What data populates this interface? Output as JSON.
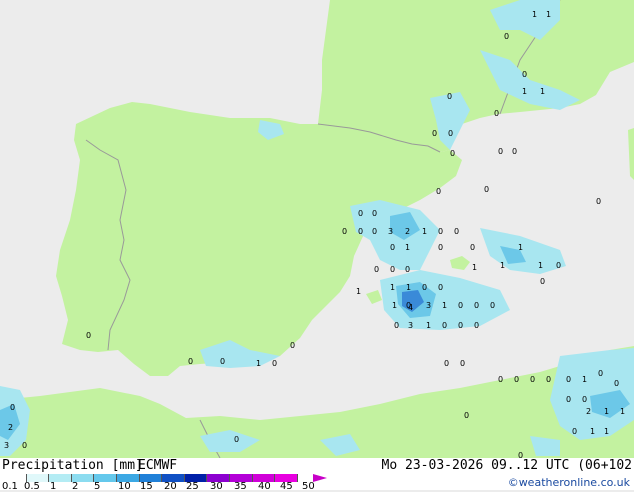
{
  "title": "Precipitation [mm]",
  "model": "ECMWF",
  "valid_time": "Mo 23-03-2026 09..12 UTC (06+102",
  "credit": "©weatheronline.co.uk",
  "colors": {
    "land": "#c3f2a0",
    "sea": "#ececec",
    "border": "#999999",
    "light_precip": "#a8e6f0",
    "medium_precip": "#6cc8e8",
    "heavy_precip": "#3a8ad8"
  },
  "scale": {
    "ticks": [
      "0.1",
      "0.5",
      "1",
      "2",
      "5",
      "10",
      "15",
      "20",
      "25",
      "30",
      "35",
      "40",
      "45",
      "50"
    ],
    "colors": [
      "#ffffff",
      "#e0f8fa",
      "#b4ecf4",
      "#8cdcf0",
      "#64c8ec",
      "#3ca8e4",
      "#2080d8",
      "#1050c4",
      "#0020a8",
      "#8c00d0",
      "#b400d8",
      "#d000d8",
      "#e800e0"
    ]
  },
  "map_labels": [
    {
      "text": "1"
    },
    {
      "text": "1"
    },
    {
      "text": "0"
    },
    {
      "text": "0"
    },
    {
      "text": "1"
    },
    {
      "text": "1"
    },
    {
      "text": "0"
    },
    {
      "text": "0"
    },
    {
      "text": "0"
    },
    {
      "text": "0"
    },
    {
      "text": "0"
    },
    {
      "text": "0"
    },
    {
      "text": "0"
    },
    {
      "text": "0"
    },
    {
      "text": "0"
    },
    {
      "text": "0"
    },
    {
      "text": "0"
    },
    {
      "text": "0"
    },
    {
      "text": "0"
    },
    {
      "text": "0"
    },
    {
      "text": "0"
    },
    {
      "text": "3"
    },
    {
      "text": "2"
    },
    {
      "text": "1"
    },
    {
      "text": "0"
    },
    {
      "text": "0"
    },
    {
      "text": "0"
    },
    {
      "text": "1"
    },
    {
      "text": "0"
    },
    {
      "text": "0"
    },
    {
      "text": "1"
    },
    {
      "text": "0"
    },
    {
      "text": "0"
    },
    {
      "text": "0"
    },
    {
      "text": "1"
    },
    {
      "text": "1"
    },
    {
      "text": "0"
    },
    {
      "text": "0"
    },
    {
      "text": "1"
    },
    {
      "text": "1"
    },
    {
      "text": "1"
    },
    {
      "text": "1"
    },
    {
      "text": "0"
    },
    {
      "text": "0"
    },
    {
      "text": "1"
    },
    {
      "text": "0"
    },
    {
      "text": "4"
    },
    {
      "text": "3"
    },
    {
      "text": "1"
    },
    {
      "text": "0"
    },
    {
      "text": "0"
    },
    {
      "text": "0"
    },
    {
      "text": "3"
    },
    {
      "text": "1"
    },
    {
      "text": "0"
    },
    {
      "text": "0"
    },
    {
      "text": "0"
    },
    {
      "text": "0"
    },
    {
      "text": "0"
    },
    {
      "text": "0"
    },
    {
      "text": "1"
    },
    {
      "text": "0"
    },
    {
      "text": "0"
    },
    {
      "text": "0"
    },
    {
      "text": "0"
    },
    {
      "text": "0"
    },
    {
      "text": "0"
    },
    {
      "text": "0"
    },
    {
      "text": "0"
    },
    {
      "text": "0"
    },
    {
      "text": "0"
    },
    {
      "text": "1"
    },
    {
      "text": "0"
    },
    {
      "text": "0"
    },
    {
      "text": "0"
    },
    {
      "text": "0"
    },
    {
      "text": "2"
    },
    {
      "text": "1"
    },
    {
      "text": "1"
    },
    {
      "text": "1"
    },
    {
      "text": "1"
    },
    {
      "text": "0"
    },
    {
      "text": "0"
    },
    {
      "text": "0"
    },
    {
      "text": "0"
    },
    {
      "text": "2"
    },
    {
      "text": "0"
    },
    {
      "text": "3"
    },
    {
      "text": "0"
    }
  ]
}
